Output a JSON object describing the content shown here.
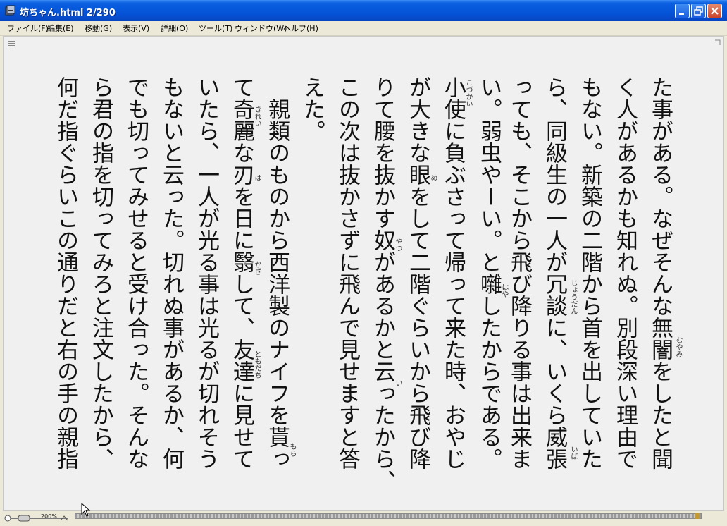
{
  "window": {
    "title": "坊ちゃん.html 2/290"
  },
  "menu": {
    "items": [
      "ファイル(F)",
      "編集(E)",
      "移動(G)",
      "表示(V)",
      "詳細(O)",
      "ツール(T)",
      "ウィンドウ(W)",
      "ヘルプ(H)"
    ]
  },
  "document": {
    "columns": [
      "た事がある。なぜそんな無闇をしたと聞",
      "く人があるかも知れぬ。別段深い理由で",
      "もない。新築の二階から首を出していた",
      "ら、同級生の一人が冗談に、いくら威張",
      "っても、そこから飛び降りる事は出来ま",
      "い。弱虫やーい。と囃したからである。",
      "小使に負ぶさって帰って来た時、おやじ",
      "が大きな眼をして二階ぐらいから飛び降",
      "りて腰を抜かす奴があるかと云ったから、",
      "この次は抜かさずに飛んで見せますと答",
      "えた。",
      "　親類のものから西洋製のナイフを貰っ",
      "て奇麗な刃を日に翳して、友達に見せて",
      "いたら、一人が光る事は光るが切れそう",
      "もないと云った。切れぬ事があるか、何",
      "でも切ってみせると受け合った。そんな",
      "ら君の指を切ってみろと注文したから、",
      "何だ指ぐらいこの通りだと右の手の親指"
    ],
    "ruby": [
      "むやみ",
      "じょうだん",
      "いば",
      "はや",
      "こづかい",
      "め",
      "やつ",
      "い",
      "もら",
      "きれい",
      "は",
      "かざ",
      "ともだち"
    ]
  },
  "status": {
    "zoom": "200%",
    "page_current": 2,
    "page_total": 290
  },
  "colors": {
    "titlebar": "#0554d8",
    "chrome": "#ece9d8",
    "page": "#f0f0f0",
    "text": "#111111"
  }
}
